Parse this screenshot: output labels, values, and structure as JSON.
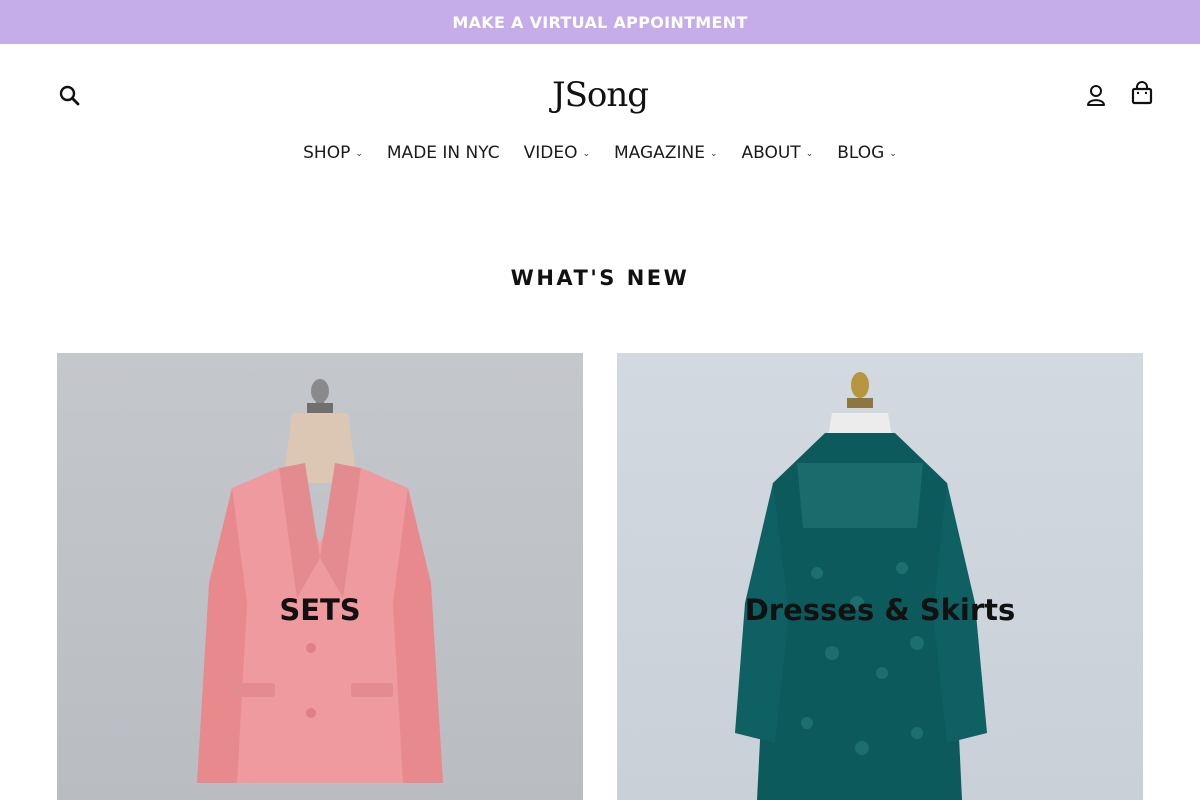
{
  "announcement": {
    "text": "MAKE A VIRTUAL APPOINTMENT"
  },
  "header": {
    "logo_text": "JSong",
    "search_icon": "search-icon",
    "account_icon": "user-icon",
    "cart_icon": "cart-icon"
  },
  "nav": {
    "items": [
      {
        "label": "SHOP",
        "has_dropdown": true
      },
      {
        "label": "MADE IN NYC",
        "has_dropdown": false
      },
      {
        "label": "VIDEO",
        "has_dropdown": true
      },
      {
        "label": "MAGAZINE",
        "has_dropdown": true
      },
      {
        "label": "ABOUT",
        "has_dropdown": true
      },
      {
        "label": "BLOG",
        "has_dropdown": true
      }
    ]
  },
  "section": {
    "title": "WHAT'S NEW"
  },
  "collections": [
    {
      "label": "SETS"
    },
    {
      "label": "Dresses & Skirts"
    }
  ],
  "colors": {
    "announcement_bg": "#c5ade9",
    "pink_suit": "#ef9a9e",
    "teal_dress": "#0c5a5c"
  }
}
